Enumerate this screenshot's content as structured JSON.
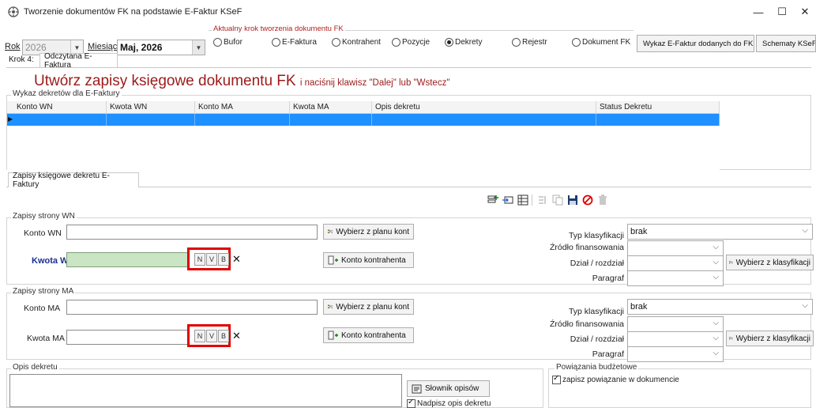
{
  "window": {
    "title": "Tworzenie dokumentów FK na podstawie E-Faktur KSeF",
    "minimize": "—",
    "maximize": "☐",
    "close": "✕"
  },
  "period": {
    "year_label": "Rok",
    "year_value": "2026",
    "month_label": "Miesiąc",
    "month_value": "Maj, 2026"
  },
  "steps": {
    "caption": "Aktualny krok tworzenia dokumentu FK",
    "items": [
      "Bufor",
      "E-Faktura",
      "Kontrahent",
      "Pozycje",
      "Dekrety",
      "Rejestr",
      "Dokument FK"
    ],
    "selected": "Dekrety"
  },
  "top_buttons": {
    "wykaz": "Wykaz E-Faktur dodanych do FK",
    "schematy": "Schematy KSeF"
  },
  "tabs": {
    "step_label": "Krok 4:",
    "read_invoice": "Odczytana E-Faktura"
  },
  "headline": {
    "main": "Utwórz zapisy księgowe dokumentu FK",
    "hint": "i naciśnij klawisz \"Dalej\" lub \"Wstecz\""
  },
  "decree_grid": {
    "caption": "Wykaz dekretów dla E-Faktury",
    "columns": [
      "Konto WN",
      "Kwota WN",
      "Konto MA",
      "Kwota MA",
      "Opis dekretu",
      "Status Dekretu"
    ]
  },
  "entries_tab": "Zapisy księgowe dekretu E-Faktury",
  "wn": {
    "caption": "Zapisy strony WN",
    "account_label": "Konto WN",
    "account_value": "",
    "amount_label": "Kwota WN",
    "amount_value": "",
    "plan_button": "Wybierz z planu kont",
    "contractor_button": "Konto kontrahenta",
    "n": "N",
    "v": "V",
    "b": "B",
    "x": "✕"
  },
  "ma": {
    "caption": "Zapisy strony MA",
    "account_label": "Konto MA",
    "account_value": "",
    "amount_label": "Kwota MA",
    "amount_value": "",
    "plan_button": "Wybierz z planu kont",
    "contractor_button": "Konto kontrahenta",
    "n": "N",
    "v": "V",
    "b": "B",
    "x": "✕"
  },
  "classification_wn": {
    "type_label": "Typ klasyfikacji",
    "type_value": "brak",
    "source_label": "Źródło finansowania",
    "section_label": "Dział / rozdział",
    "paragraph_label": "Paragraf",
    "choose_button": "Wybierz z klasyfikacji"
  },
  "classification_ma": {
    "type_label": "Typ klasyfikacji",
    "type_value": "brak",
    "source_label": "Źródło finansowania",
    "section_label": "Dział / rozdział",
    "paragraph_label": "Paragraf",
    "choose_button": "Wybierz z klasyfikacji"
  },
  "description": {
    "caption": "Opis dekretu",
    "dictionary_button": "Słownik opisów",
    "overwrite_label": "Nadpisz opis dekretu"
  },
  "budget": {
    "caption": "Powiązania budżetowe",
    "save_link_label": "zapisz powiązanie w dokumencie"
  },
  "colors": {
    "accent_red": "#9b1a1a",
    "selection_blue": "#1e90ff",
    "highlight_box": "#e00000",
    "green_input": "#c9e5c3"
  }
}
